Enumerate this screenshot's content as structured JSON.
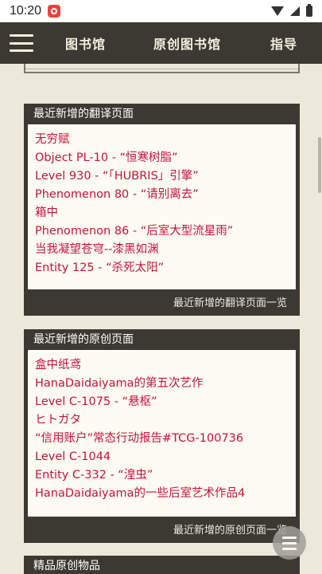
{
  "status_bar": {
    "time": "10:20"
  },
  "nav": {
    "items": [
      "图书馆",
      "原创图书馆",
      "指导"
    ]
  },
  "sections": [
    {
      "title": "最近新增的翻译页面",
      "items": [
        "无穷赋",
        "Object PL-10 - “恒寒树脂”",
        "Level 930 - “「HUBRIS」引擎”",
        "Phenomenon 80 - “请别离去”",
        "箱中",
        "Phenomenon 86 - “后室大型流星雨”",
        "当我凝望苍穹--漆黑如渊",
        "Entity 125 - “杀死太阳”"
      ],
      "footer": "最近新增的翻译页面一览"
    },
    {
      "title": "最近新增的原创页面",
      "items": [
        "盒中纸鸢",
        "HanaDaidaiyama的第五次艺作",
        "Level C-1075 - “悬枢”",
        "ヒトガタ",
        "“信用账户”常态行动报告#TCG-100736",
        "Level C-1044",
        "Entity C-332 - “湟虫”",
        "HanaDaidaiyama的一些后室艺术作品4"
      ],
      "footer": "最近新增的原创页面一览"
    },
    {
      "title": "精品原创物品"
    }
  ]
}
